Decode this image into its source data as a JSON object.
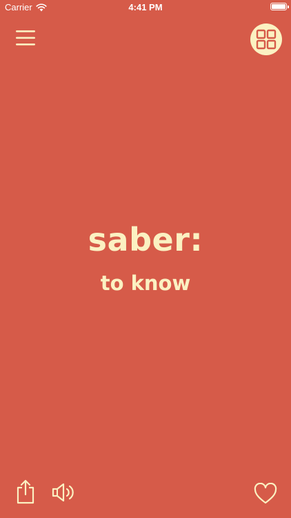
{
  "status_bar": {
    "carrier": "Carrier",
    "time": "4:41 PM"
  },
  "card": {
    "word": "saber:",
    "meaning": "to know"
  },
  "icons": {
    "menu": "hamburger-menu-icon",
    "grid": "grid-icon",
    "share": "share-icon",
    "sound": "speaker-icon",
    "favorite": "heart-icon"
  },
  "colors": {
    "background": "#d65b49",
    "accent": "#fbf1c2"
  }
}
